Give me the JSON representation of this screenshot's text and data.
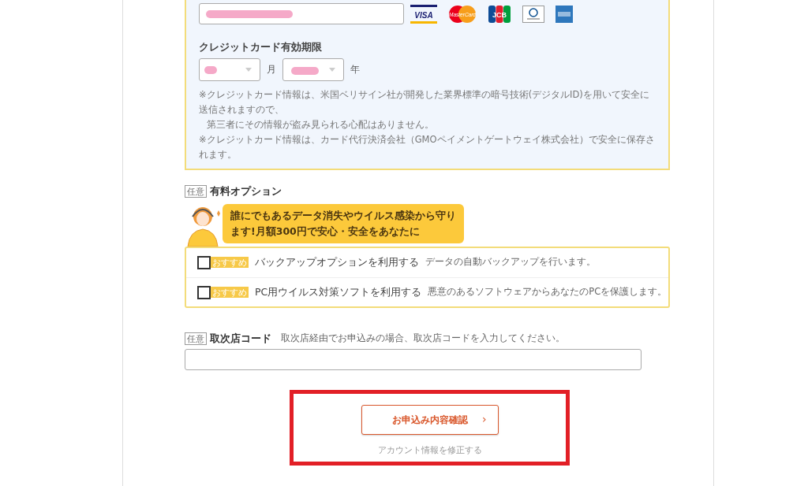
{
  "card_logos": [
    {
      "kind": "visa",
      "text": "VISA"
    },
    {
      "kind": "mastercard",
      "text": "MasterCard"
    },
    {
      "kind": "jcb",
      "text": "JCB"
    },
    {
      "kind": "diners"
    },
    {
      "kind": "amex"
    }
  ],
  "expiry": {
    "label": "クレジットカード有効期限",
    "month_unit": "月",
    "year_unit": "年"
  },
  "notes": [
    {
      "text": "※クレジットカード情報は、米国ベリサイン社が開発した業界標準の暗号技術(デジタルID)を用いて安全に送信されますので、",
      "indent": false
    },
    {
      "text": "第三者にその情報が盗み見られる心配はありません。",
      "indent": true
    },
    {
      "text": "※クレジットカード情報は、カード代行決済会社（GMOペイメントゲートウェイ株式会社）で安全に保存されます。",
      "indent": false
    }
  ],
  "options": {
    "tag": "任意",
    "title": "有料オプション",
    "speech": [
      "誰にでもあるデータ消失やウイルス感染から守り",
      "ます!月額300円で安心・安全をあなたに"
    ],
    "items": [
      {
        "badge": "おすすめ",
        "label": "バックアップオプションを利用する",
        "description": "データの自動バックアップを行います。",
        "checked": false
      },
      {
        "badge": "おすすめ",
        "label": "PC用ウイルス対策ソフトを利用する",
        "description": "悪意のあるソフトウェアからあなたのPCを保護します。",
        "checked": false
      }
    ]
  },
  "agent_code": {
    "tag": "任意",
    "title": "取次店コード",
    "hint": "取次店経由でお申込みの場合、取次店コードを入力してください。"
  },
  "submit": {
    "label": "お申込み内容確認",
    "chevron": "›"
  },
  "edit_link": "アカウント情報を修正する"
}
